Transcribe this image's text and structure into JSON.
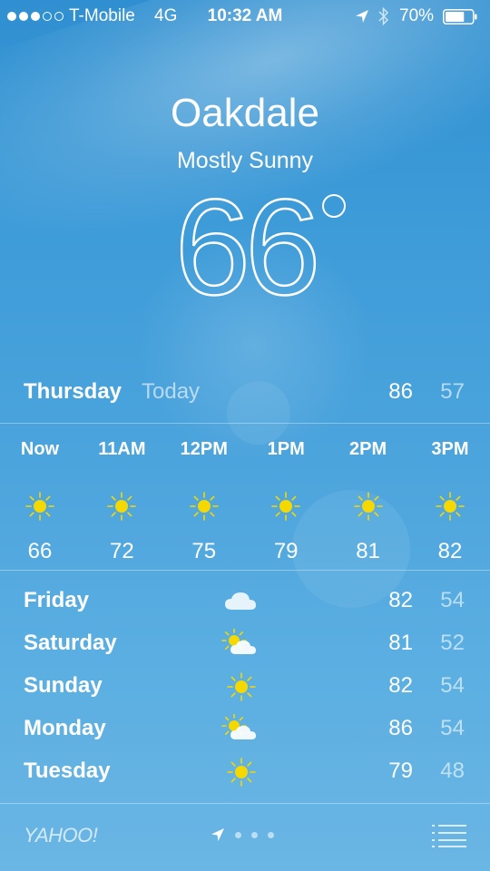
{
  "status_bar": {
    "carrier": "T-Mobile",
    "network": "4G",
    "time": "10:32 AM",
    "battery": "70%",
    "signal_bars_on": 3,
    "signal_bars_total": 5
  },
  "location": {
    "city": "Oakdale",
    "condition": "Mostly Sunny",
    "temperature": "66"
  },
  "today": {
    "day": "Thursday",
    "label": "Today",
    "high": "86",
    "low": "57"
  },
  "hourly": [
    {
      "time": "Now",
      "icon": "sun-icon",
      "temp": "66"
    },
    {
      "time": "11AM",
      "icon": "sun-icon",
      "temp": "72"
    },
    {
      "time": "12PM",
      "icon": "sun-icon",
      "temp": "75"
    },
    {
      "time": "1PM",
      "icon": "sun-icon",
      "temp": "79"
    },
    {
      "time": "2PM",
      "icon": "sun-icon",
      "temp": "81"
    },
    {
      "time": "3PM",
      "icon": "sun-icon",
      "temp": "82"
    }
  ],
  "daily": [
    {
      "day": "Friday",
      "icon": "cloud-icon",
      "high": "82",
      "low": "54"
    },
    {
      "day": "Saturday",
      "icon": "partly-cloudy-icon",
      "high": "81",
      "low": "52"
    },
    {
      "day": "Sunday",
      "icon": "sun-icon",
      "high": "82",
      "low": "54"
    },
    {
      "day": "Monday",
      "icon": "partly-cloudy-icon",
      "high": "86",
      "low": "54"
    },
    {
      "day": "Tuesday",
      "icon": "sun-icon",
      "high": "79",
      "low": "48"
    }
  ],
  "footer": {
    "brand": "YAHOO!",
    "page_count": 4
  },
  "colors": {
    "sun": "#f5d800",
    "sky_top": "#2f8fd0",
    "sky_bottom": "#6ab6e4"
  }
}
